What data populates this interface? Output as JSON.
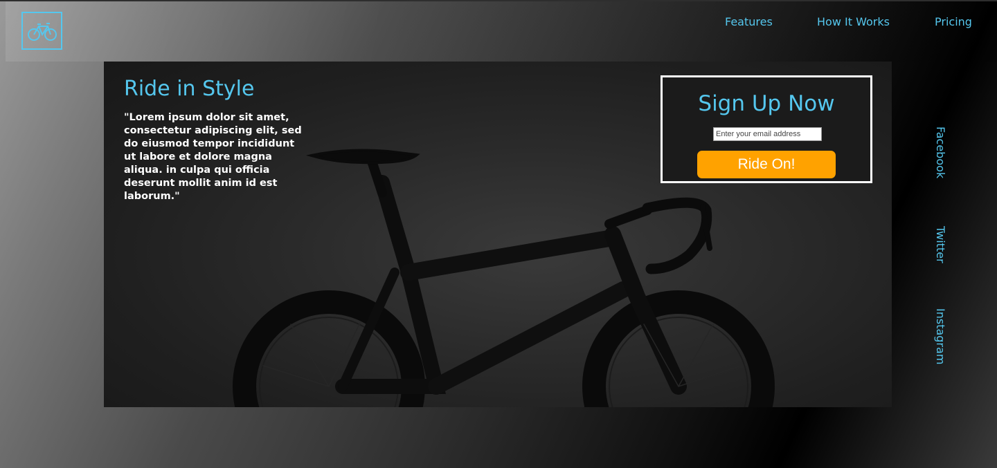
{
  "nav": {
    "logo_icon": "bicycle-icon",
    "links": [
      "Features",
      "How It Works",
      "Pricing"
    ]
  },
  "hero": {
    "title": "Ride in Style",
    "quote": "\"Lorem ipsum dolor sit amet, consectetur adipiscing elit, sed do eiusmod tempor incididunt ut labore et dolore magna aliqua. in culpa qui officia deserunt mollit anim id est laborum.\""
  },
  "signup": {
    "title": "Sign Up Now",
    "email_placeholder": "Enter your email address",
    "button_label": "Ride On!"
  },
  "social": [
    "Facebook",
    "Twitter",
    "Instagram"
  ],
  "colors": {
    "accent": "#55c7ee",
    "button": "#ffa200"
  }
}
